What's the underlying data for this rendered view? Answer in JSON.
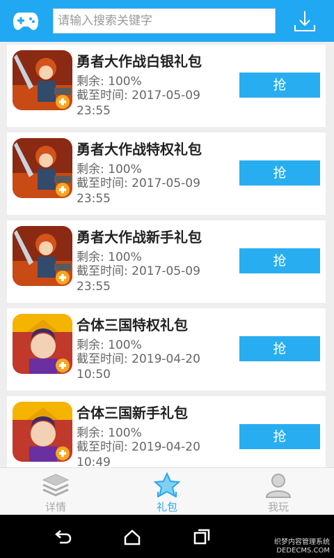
{
  "header": {
    "search_placeholder": "请输入搜索关键字",
    "accent": "#21a8f3"
  },
  "gifts": [
    {
      "title": "勇者大作战白银礼包",
      "remain": "剩余: 100%",
      "deadline": "截至时间: 2017-05-09 23:55",
      "button": "抢",
      "icon": "warrior-game-icon"
    },
    {
      "title": "勇者大作战特权礼包",
      "remain": "剩余: 100%",
      "deadline": "截至时间: 2017-05-09 23:55",
      "button": "抢",
      "icon": "warrior-game-icon"
    },
    {
      "title": "勇者大作战新手礼包",
      "remain": "剩余: 100%",
      "deadline": "截至时间: 2017-05-09 23:55",
      "button": "抢",
      "icon": "warrior-game-icon"
    },
    {
      "title": "合体三国特权礼包",
      "remain": "剩余: 100%",
      "deadline": "截至时间: 2019-04-20 10:50",
      "button": "抢",
      "icon": "three-kingdoms-game-icon"
    },
    {
      "title": "合体三国新手礼包",
      "remain": "剩余: 100%",
      "deadline": "截至时间: 2019-04-20 10:49",
      "button": "抢",
      "icon": "three-kingdoms-game-icon"
    }
  ],
  "tabs": [
    {
      "label": "详情",
      "icon": "layers-icon",
      "active": false
    },
    {
      "label": "礼包",
      "icon": "star-icon",
      "active": true
    },
    {
      "label": "我玩",
      "icon": "person-icon",
      "active": false
    }
  ],
  "watermark": {
    "line1": "织梦内容管理系统",
    "line2": "DEDECMS.COM"
  }
}
